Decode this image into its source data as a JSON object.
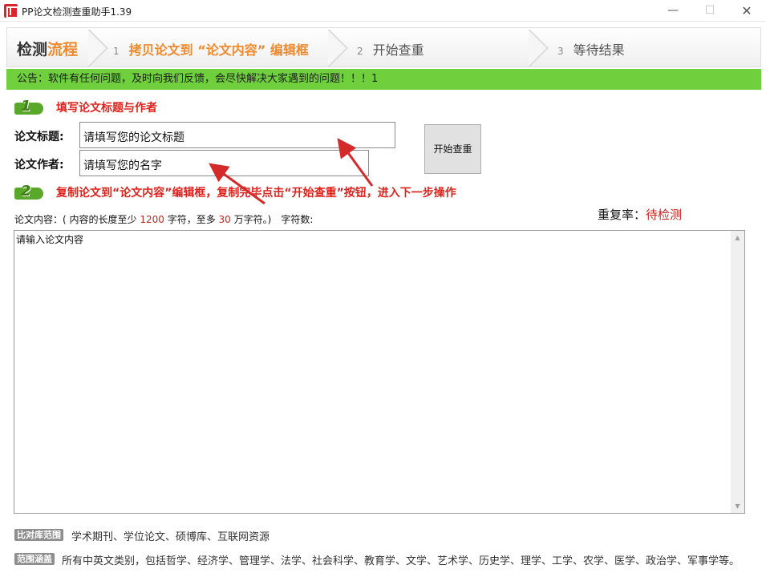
{
  "window": {
    "title": "PP论文检测查重助手1.39",
    "controls": {
      "minimize": "—",
      "maximize": "☐",
      "close": "✕"
    }
  },
  "steps": {
    "label_prefix": "检测",
    "label_accent": "流程",
    "items": [
      {
        "num": "1",
        "text": "拷贝论文到 “论文内容” 编辑框"
      },
      {
        "num": "2",
        "text": "开始查重"
      },
      {
        "num": "3",
        "text": "等待结果"
      }
    ]
  },
  "notice": "公告：软件有任何问题，及时向我们反馈，会尽快解决大家遇到的问题！！！1",
  "section1": {
    "badge": "1",
    "title": "填写论文标题与作者"
  },
  "form": {
    "title_label": "论文标题:",
    "title_value": "请填写您的论文标题",
    "author_label": "论文作者:",
    "author_value": "请填写您的名字",
    "start_button": "开始查重"
  },
  "section2": {
    "badge": "2",
    "title": "复制论文到“论文内容”编辑框，复制完毕点击“开始查重”按钮，进入下一步操作"
  },
  "rate": {
    "label": "重复率：",
    "value": "待检测"
  },
  "content": {
    "label_prefix": "论文内容：( 内容的长度至少",
    "min": "1200",
    "label_mid": "字符，至多",
    "max": "30",
    "label_suffix": "万字符。)",
    "charcount_label": "字符数:",
    "placeholder": "请输入论文内容"
  },
  "footer": {
    "tag1": "比对库范围",
    "line1": "学术期刊、学位论文、硕博库、互联网资源",
    "tag2": "范围涵盖",
    "line2": "所有中英文类别，包括哲学、经济学、管理学、法学、社会科学、教育学、文学、艺术学、历史学、理学、工学、农学、医学、政治学、军事学等。"
  },
  "colors": {
    "accent_orange": "#f08a2e",
    "notice_green": "#6fcf3c",
    "highlight_red": "#c9241f",
    "arrow_red": "#d42a2a"
  }
}
